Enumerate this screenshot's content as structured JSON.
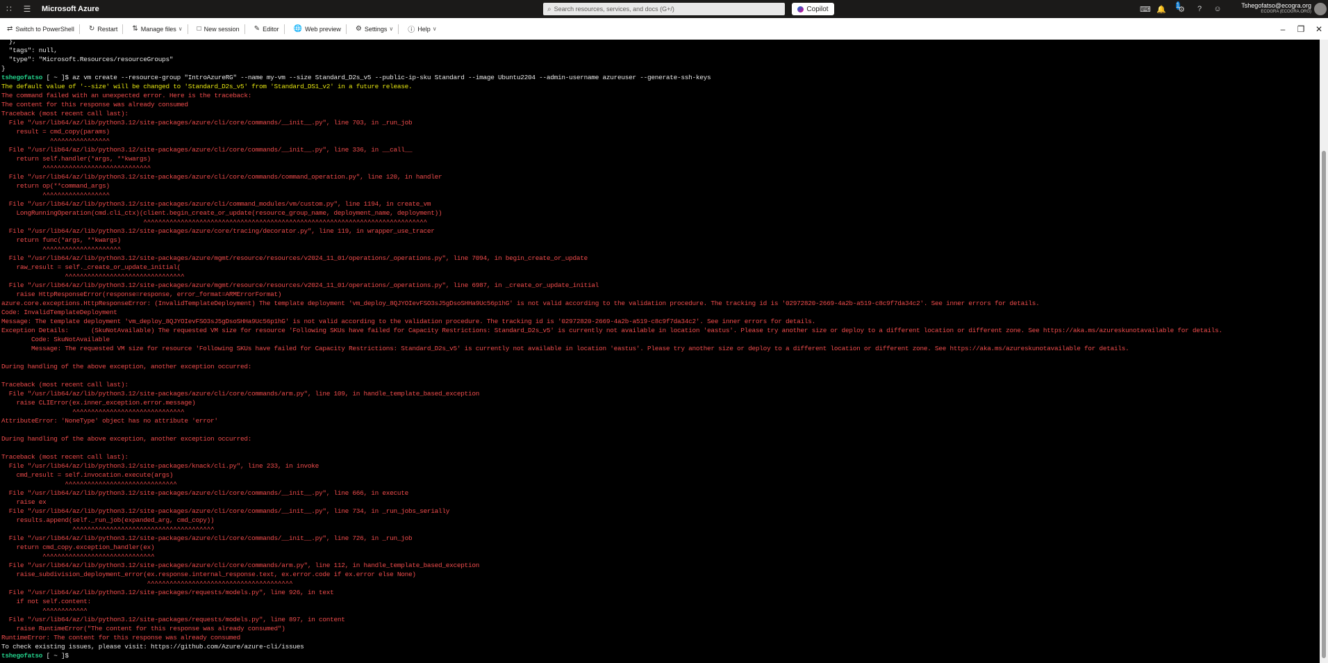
{
  "topbar": {
    "brand": "Microsoft Azure",
    "search_placeholder": "Search resources, services, and docs (G+/)",
    "copilot_label": "Copilot",
    "notification_count": "1",
    "account_name": "Tshegofatso@ecogra.org",
    "account_directory": "ECOGRA (ECOGRA.ORG)"
  },
  "toolbar": {
    "switch": "Switch to PowerShell",
    "restart": "Restart",
    "manage_files": "Manage files",
    "new_session": "New session",
    "editor": "Editor",
    "web_preview": "Web preview",
    "settings": "Settings",
    "help": "Help"
  },
  "terminal": {
    "lines": [
      {
        "t": "  },",
        "c": "w"
      },
      {
        "t": "  \"tags\": null,",
        "c": "w"
      },
      {
        "t": "  \"type\": \"Microsoft.Resources/resourceGroups\"",
        "c": "w"
      },
      {
        "t": "}",
        "c": "w"
      },
      {
        "t": "az vm create --resource-group \"IntroAzureRG\" --name my-vm --size Standard_D2s_v5 --public-ip-sku Standard --image Ubuntu2204 --admin-username azureuser --generate-ssh-keys",
        "c": "w",
        "prompt": "tshegofatso",
        "path": " [ ~ ]$ "
      },
      {
        "t": "The default value of '--size' will be changed to 'Standard_D2s_v5' from 'Standard_DS1_v2' in a future release.",
        "c": "y"
      },
      {
        "t": "The command failed with an unexpected error. Here is the traceback:",
        "c": "r"
      },
      {
        "t": "The content for this response was already consumed",
        "c": "r"
      },
      {
        "t": "Traceback (most recent call last):",
        "c": "r"
      },
      {
        "t": "  File \"/usr/lib64/az/lib/python3.12/site-packages/azure/cli/core/commands/__init__.py\", line 703, in _run_job",
        "c": "r"
      },
      {
        "t": "    result = cmd_copy(params)",
        "c": "r"
      },
      {
        "t": "             ^^^^^^^^^^^^^^^^",
        "c": "r"
      },
      {
        "t": "  File \"/usr/lib64/az/lib/python3.12/site-packages/azure/cli/core/commands/__init__.py\", line 336, in __call__",
        "c": "r"
      },
      {
        "t": "    return self.handler(*args, **kwargs)",
        "c": "r"
      },
      {
        "t": "           ^^^^^^^^^^^^^^^^^^^^^^^^^^^^^",
        "c": "r"
      },
      {
        "t": "  File \"/usr/lib64/az/lib/python3.12/site-packages/azure/cli/core/commands/command_operation.py\", line 120, in handler",
        "c": "r"
      },
      {
        "t": "    return op(**command_args)",
        "c": "r"
      },
      {
        "t": "           ^^^^^^^^^^^^^^^^^^",
        "c": "r"
      },
      {
        "t": "  File \"/usr/lib64/az/lib/python3.12/site-packages/azure/cli/command_modules/vm/custom.py\", line 1194, in create_vm",
        "c": "r"
      },
      {
        "t": "    LongRunningOperation(cmd.cli_ctx)(client.begin_create_or_update(resource_group_name, deployment_name, deployment))",
        "c": "r"
      },
      {
        "t": "                                      ^^^^^^^^^^^^^^^^^^^^^^^^^^^^^^^^^^^^^^^^^^^^^^^^^^^^^^^^^^^^^^^^^^^^^^^^^^^^",
        "c": "r"
      },
      {
        "t": "  File \"/usr/lib64/az/lib/python3.12/site-packages/azure/core/tracing/decorator.py\", line 119, in wrapper_use_tracer",
        "c": "r"
      },
      {
        "t": "    return func(*args, **kwargs)",
        "c": "r"
      },
      {
        "t": "           ^^^^^^^^^^^^^^^^^^^^^",
        "c": "r"
      },
      {
        "t": "  File \"/usr/lib64/az/lib/python3.12/site-packages/azure/mgmt/resource/resources/v2024_11_01/operations/_operations.py\", line 7094, in begin_create_or_update",
        "c": "r"
      },
      {
        "t": "    raw_result = self._create_or_update_initial(",
        "c": "r"
      },
      {
        "t": "                 ^^^^^^^^^^^^^^^^^^^^^^^^^^^^^^^^",
        "c": "r"
      },
      {
        "t": "  File \"/usr/lib64/az/lib/python3.12/site-packages/azure/mgmt/resource/resources/v2024_11_01/operations/_operations.py\", line 6987, in _create_or_update_initial",
        "c": "r"
      },
      {
        "t": "    raise HttpResponseError(response=response, error_format=ARMErrorFormat)",
        "c": "r"
      },
      {
        "t": "azure.core.exceptions.HttpResponseError: (InvalidTemplateDeployment) The template deployment 'vm_deploy_8QJYOIevFSO3sJ5gDsoSHHa9Uc56p1hG' is not valid according to the validation procedure. The tracking id is '02972820-2669-4a2b-a519-c8c9f7da34c2'. See inner errors for details.",
        "c": "r"
      },
      {
        "t": "Code: InvalidTemplateDeployment",
        "c": "r"
      },
      {
        "t": "Message: The template deployment 'vm_deploy_8QJYOIevFSO3sJ5gDsoSHHa9Uc56p1hG' is not valid according to the validation procedure. The tracking id is '02972820-2669-4a2b-a519-c8c9f7da34c2'. See inner errors for details.",
        "c": "r"
      },
      {
        "t": "Exception Details:      (SkuNotAvailable) The requested VM size for resource 'Following SKUs have failed for Capacity Restrictions: Standard_D2s_v5' is currently not available in location 'eastus'. Please try another size or deploy to a different location or different zone. See https://aka.ms/azureskunotavailable for details.",
        "c": "r"
      },
      {
        "t": "        Code: SkuNotAvailable",
        "c": "r"
      },
      {
        "t": "        Message: The requested VM size for resource 'Following SKUs have failed for Capacity Restrictions: Standard_D2s_v5' is currently not available in location 'eastus'. Please try another size or deploy to a different location or different zone. See https://aka.ms/azureskunotavailable for details.",
        "c": "r"
      },
      {
        "t": "",
        "c": "r"
      },
      {
        "t": "During handling of the above exception, another exception occurred:",
        "c": "r"
      },
      {
        "t": "",
        "c": "r"
      },
      {
        "t": "Traceback (most recent call last):",
        "c": "r"
      },
      {
        "t": "  File \"/usr/lib64/az/lib/python3.12/site-packages/azure/cli/core/commands/arm.py\", line 109, in handle_template_based_exception",
        "c": "r"
      },
      {
        "t": "    raise CLIError(ex.inner_exception.error.message)",
        "c": "r"
      },
      {
        "t": "                   ^^^^^^^^^^^^^^^^^^^^^^^^^^^^^^",
        "c": "r"
      },
      {
        "t": "AttributeError: 'NoneType' object has no attribute 'error'",
        "c": "r"
      },
      {
        "t": "",
        "c": "r"
      },
      {
        "t": "During handling of the above exception, another exception occurred:",
        "c": "r"
      },
      {
        "t": "",
        "c": "r"
      },
      {
        "t": "Traceback (most recent call last):",
        "c": "r"
      },
      {
        "t": "  File \"/usr/lib64/az/lib/python3.12/site-packages/knack/cli.py\", line 233, in invoke",
        "c": "r"
      },
      {
        "t": "    cmd_result = self.invocation.execute(args)",
        "c": "r"
      },
      {
        "t": "                 ^^^^^^^^^^^^^^^^^^^^^^^^^^^^^^",
        "c": "r"
      },
      {
        "t": "  File \"/usr/lib64/az/lib/python3.12/site-packages/azure/cli/core/commands/__init__.py\", line 666, in execute",
        "c": "r"
      },
      {
        "t": "    raise ex",
        "c": "r"
      },
      {
        "t": "  File \"/usr/lib64/az/lib/python3.12/site-packages/azure/cli/core/commands/__init__.py\", line 734, in _run_jobs_serially",
        "c": "r"
      },
      {
        "t": "    results.append(self._run_job(expanded_arg, cmd_copy))",
        "c": "r"
      },
      {
        "t": "                   ^^^^^^^^^^^^^^^^^^^^^^^^^^^^^^^^^^^^^^",
        "c": "r"
      },
      {
        "t": "  File \"/usr/lib64/az/lib/python3.12/site-packages/azure/cli/core/commands/__init__.py\", line 726, in _run_job",
        "c": "r"
      },
      {
        "t": "    return cmd_copy.exception_handler(ex)",
        "c": "r"
      },
      {
        "t": "           ^^^^^^^^^^^^^^^^^^^^^^^^^^^^^^",
        "c": "r"
      },
      {
        "t": "  File \"/usr/lib64/az/lib/python3.12/site-packages/azure/cli/core/commands/arm.py\", line 112, in handle_template_based_exception",
        "c": "r"
      },
      {
        "t": "    raise_subdivision_deployment_error(ex.response.internal_response.text, ex.error.code if ex.error else None)",
        "c": "r"
      },
      {
        "t": "                                       ^^^^^^^^^^^^^^^^^^^^^^^^^^^^^^^^^^^^^^^",
        "c": "r"
      },
      {
        "t": "  File \"/usr/lib64/az/lib/python3.12/site-packages/requests/models.py\", line 926, in text",
        "c": "r"
      },
      {
        "t": "    if not self.content:",
        "c": "r"
      },
      {
        "t": "           ^^^^^^^^^^^^",
        "c": "r"
      },
      {
        "t": "  File \"/usr/lib64/az/lib/python3.12/site-packages/requests/models.py\", line 897, in content",
        "c": "r"
      },
      {
        "t": "    raise RuntimeError(\"The content for this response was already consumed\")",
        "c": "r"
      },
      {
        "t": "RuntimeError: The content for this response was already consumed",
        "c": "r"
      },
      {
        "t": "To check existing issues, please visit: https://github.com/Azure/azure-cli/issues",
        "c": "w"
      },
      {
        "t": "",
        "c": "w",
        "prompt": "tshegofatso",
        "path": " [ ~ ]$ "
      }
    ]
  }
}
